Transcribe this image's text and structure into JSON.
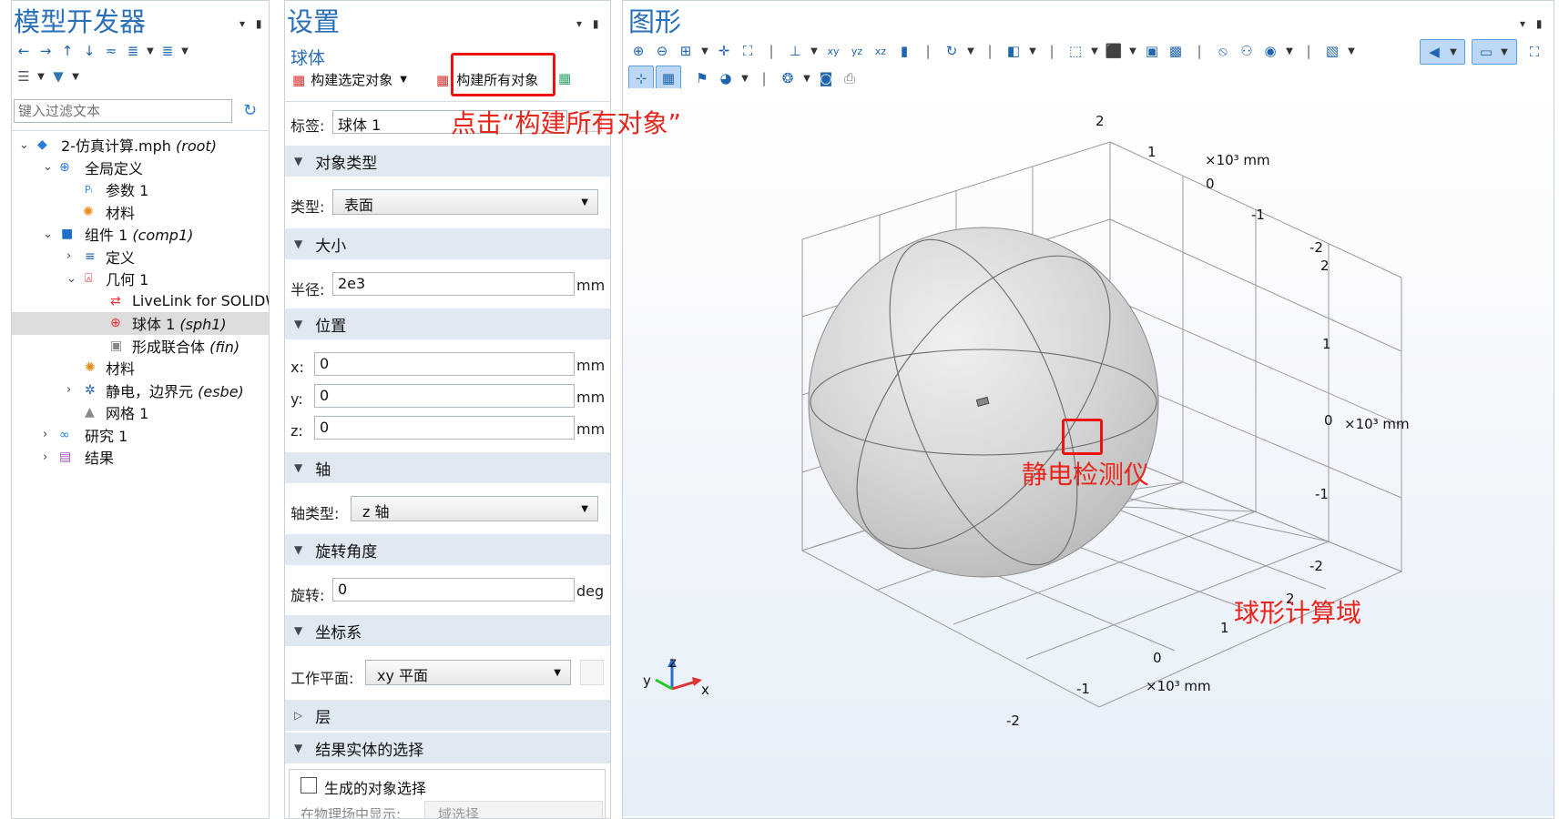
{
  "model_builder": {
    "title": "模型开发器",
    "filter_placeholder": "键入过滤文本",
    "tree": [
      {
        "label": "2-仿真计算.mph",
        "tag": "(root)",
        "icon": "root-icon"
      },
      {
        "label": "全局定义",
        "tag": "",
        "icon": "globe-icon"
      },
      {
        "label": "参数 1",
        "tag": "",
        "icon": "parameters-icon"
      },
      {
        "label": "材料",
        "tag": "",
        "icon": "materials-icon"
      },
      {
        "label": "组件 1",
        "tag": "(comp1)",
        "icon": "component-icon"
      },
      {
        "label": "定义",
        "tag": "",
        "icon": "definitions-icon"
      },
      {
        "label": "几何 1",
        "tag": "",
        "icon": "geometry-icon"
      },
      {
        "label": "LiveLink for SOLIDWORKS",
        "tag": "",
        "icon": "livelink-icon"
      },
      {
        "label": "球体 1",
        "tag": "(sph1)",
        "icon": "sphere-icon"
      },
      {
        "label": "形成联合体",
        "tag": "(fin)",
        "icon": "form-union-icon"
      },
      {
        "label": "材料",
        "tag": "",
        "icon": "materials-icon"
      },
      {
        "label": "静电，边界元",
        "tag": "(esbe)",
        "icon": "electrostatics-icon"
      },
      {
        "label": "网格 1",
        "tag": "",
        "icon": "mesh-icon"
      },
      {
        "label": "研究 1",
        "tag": "",
        "icon": "study-icon"
      },
      {
        "label": "结果",
        "tag": "",
        "icon": "results-icon"
      }
    ]
  },
  "settings": {
    "title": "设置",
    "subtitle": "球体",
    "build_selected": "构建选定对象",
    "build_all": "构建所有对象",
    "label_label": "标签:",
    "label_value": "球体 1",
    "sections": {
      "object_type": "对象类型",
      "size": "大小",
      "position": "位置",
      "axis": "轴",
      "rotation_angle": "旋转角度",
      "coordinate_system": "坐标系",
      "layers": "层",
      "resulting_selection": "结果实体的选择"
    },
    "type_label": "类型:",
    "type_value": "表面",
    "radius_label": "半径:",
    "radius_value": "2e3",
    "x_label": "x:",
    "x_value": "0",
    "y_label": "y:",
    "y_value": "0",
    "z_label": "z:",
    "z_value": "0",
    "axis_type_label": "轴类型:",
    "axis_type_value": "z 轴",
    "rotation_label": "旋转:",
    "rotation_value": "0",
    "workplane_label": "工作平面:",
    "workplane_value": "xy 平面",
    "unit_mm": "mm",
    "unit_deg": "deg",
    "generate_selection": "生成的对象选择",
    "show_in_physics_label": "在物理场中显示:",
    "show_in_physics_value": "域选择"
  },
  "graphics": {
    "title": "图形",
    "unit_label": "×10³ mm",
    "axis_x": "x",
    "axis_y": "y",
    "axis_z": "z",
    "ticks": [
      "2",
      "1",
      "0",
      "-1",
      "-2",
      "2",
      "1",
      "0",
      "-1",
      "-2",
      "2",
      "1",
      "0",
      "-1",
      "-2"
    ]
  },
  "annotations": {
    "click_hint": "点击“构建所有对象”",
    "detector": "静电检测仪",
    "domain": "球形计算域"
  },
  "colors": {
    "accent": "#2a6fb8",
    "highlight": "#e11111",
    "section_bg": "#e0e9f1",
    "graphics_bg": "#ffffff"
  }
}
